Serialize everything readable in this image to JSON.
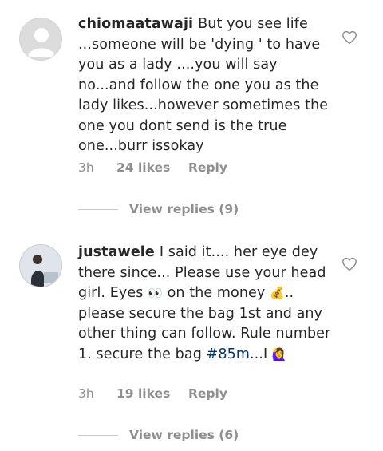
{
  "comments": [
    {
      "username": "chiomaatawaji",
      "text": "But you see life ...someone will be 'dying ' to have you as a lady ....you will say no...and follow the one you as the lady likes...however sometimes the one you dont send is the true one...burr issokay",
      "time": "3h",
      "likes": "24 likes",
      "reply": "Reply",
      "view_replies": "View replies (9)",
      "avatar": "default-avatar"
    },
    {
      "username": "justawele",
      "text_before": "I said it.... her eye dey there since... Please use your head girl. Eyes ",
      "emoji_eyes": "👀",
      "text_mid": " on the money ",
      "emoji_bag": "💰",
      "text_after": ".. please secure the bag 1st and any other thing can follow. Rule number 1. secure the bag ",
      "hashtag": "#85m",
      "text_end": "...I ",
      "emoji_end": "🙋‍♀️",
      "time": "3h",
      "likes": "19 likes",
      "reply": "Reply",
      "view_replies": "View replies (6)",
      "avatar": "photo-avatar"
    }
  ],
  "icons": {
    "like": "heart-outline-icon"
  },
  "colors": {
    "text": "#262626",
    "meta": "#8e8e8e",
    "hashtag": "#003569"
  }
}
